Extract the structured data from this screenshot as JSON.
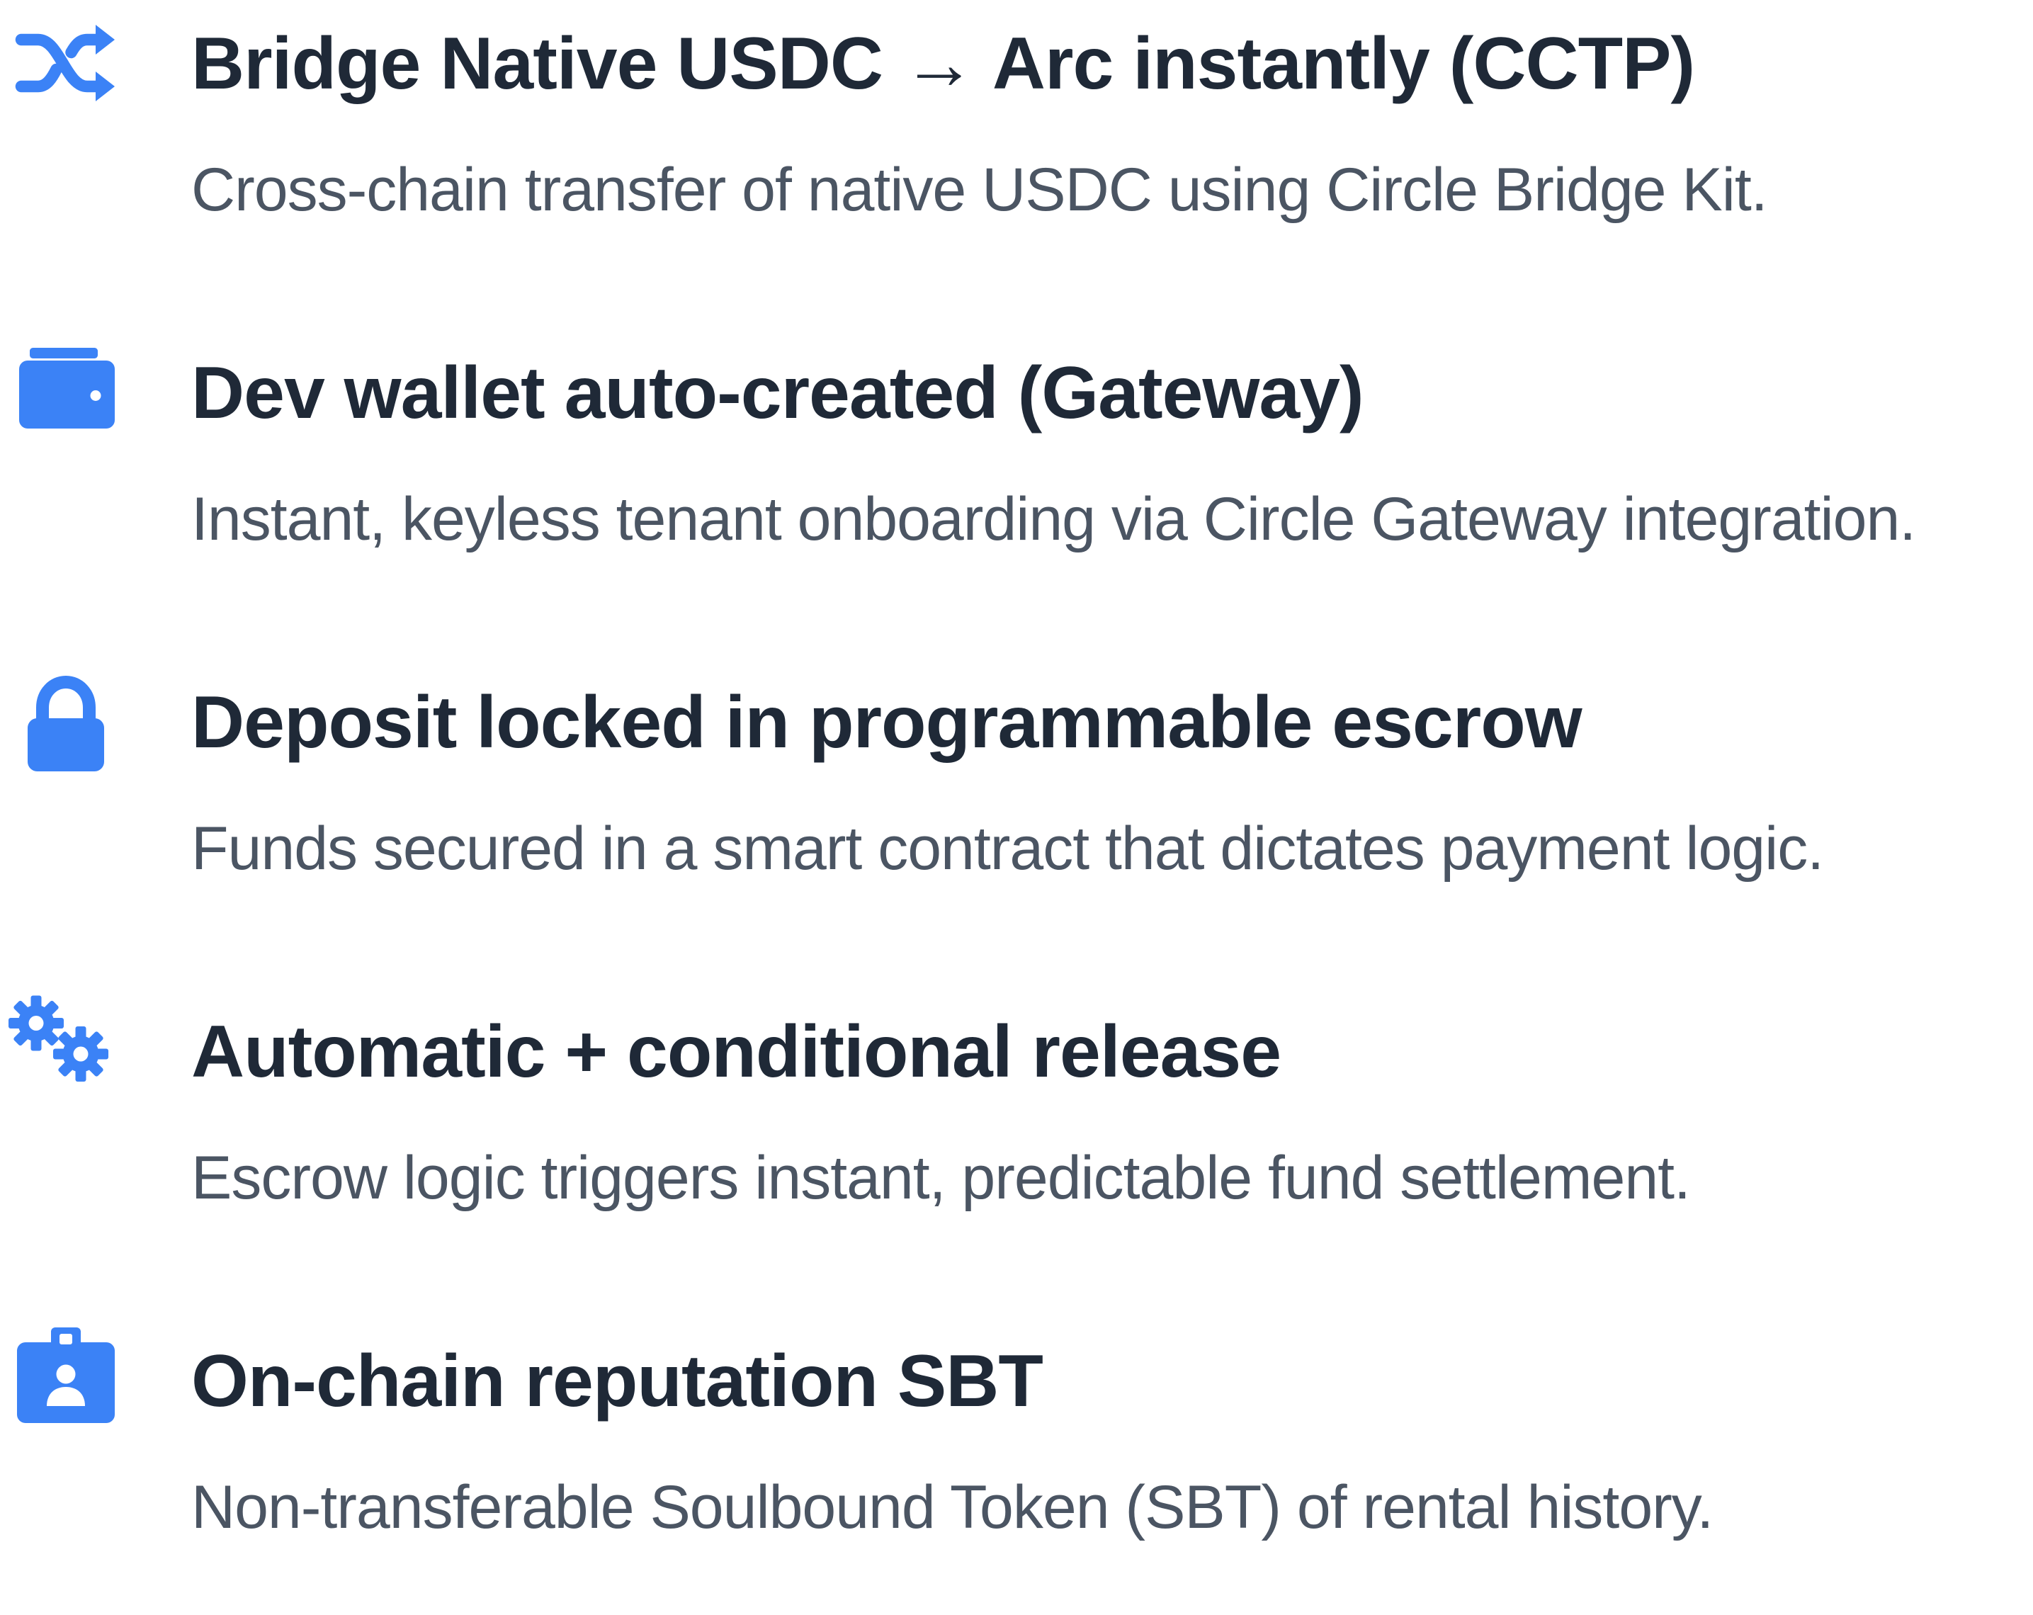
{
  "accent_color": "#3b82f6",
  "features": [
    {
      "icon": "shuffle-icon",
      "title": "Bridge Native USDC → Arc instantly (CCTP)",
      "description": "Cross-chain transfer of native USDC using Circle Bridge Kit."
    },
    {
      "icon": "wallet-icon",
      "title": "Dev wallet auto-created (Gateway)",
      "description": "Instant, keyless tenant onboarding via Circle Gateway integration."
    },
    {
      "icon": "lock-icon",
      "title": "Deposit locked in programmable escrow",
      "description": "Funds secured in a smart contract that dictates payment logic."
    },
    {
      "icon": "gears-icon",
      "title": "Automatic + conditional release",
      "description": "Escrow logic triggers instant, predictable fund settlement."
    },
    {
      "icon": "id-badge-icon",
      "title": "On-chain reputation SBT",
      "description": "Non-transferable Soulbound Token (SBT) of rental history."
    }
  ]
}
